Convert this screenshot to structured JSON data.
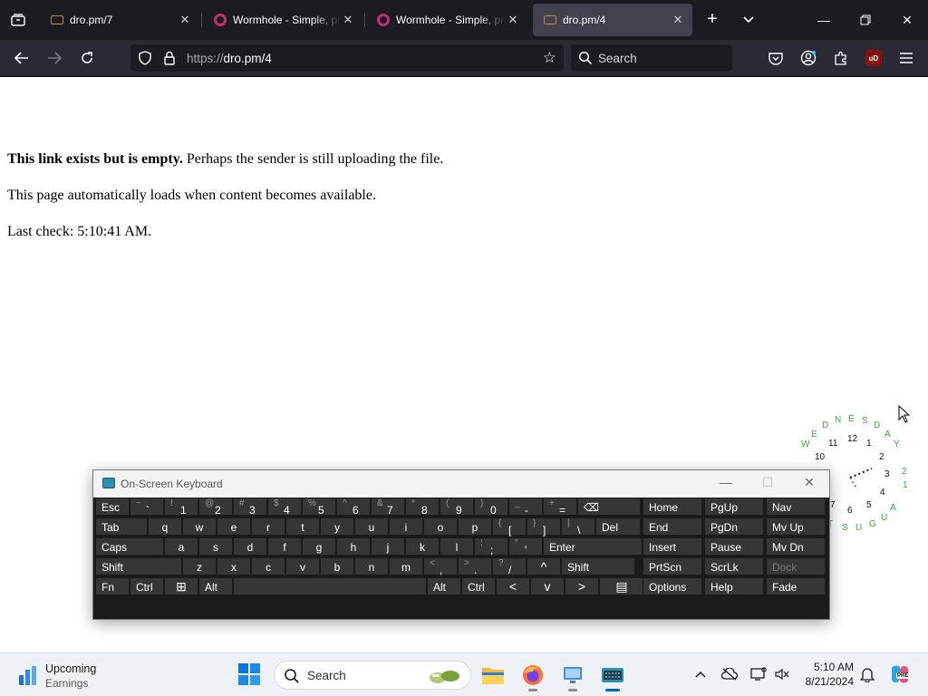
{
  "browser": {
    "tabs": [
      {
        "title": "dro.pm/7",
        "active": false,
        "favicon": "folder-favicon"
      },
      {
        "title": "Wormhole - Simple, private file sharing",
        "active": false,
        "favicon": "wormhole-favicon"
      },
      {
        "title": "Wormhole - Simple, private file sharing",
        "active": false,
        "favicon": "wormhole-favicon"
      },
      {
        "title": "dro.pm/4",
        "active": true,
        "favicon": "folder-favicon"
      }
    ],
    "url_prefix": "https://",
    "url_main": "dro.pm/4",
    "search_placeholder": "Search",
    "extension_badge": "uD"
  },
  "page": {
    "line1_bold": "This link exists but is empty.",
    "line1_rest": " Perhaps the sender is still uploading the file.",
    "line2": "This page automatically loads when content becomes available.",
    "line3": "Last check: 5:10:41 AM."
  },
  "clock": {
    "day_letters": [
      "W",
      "E",
      "D",
      "N",
      "E",
      "S",
      "D",
      "A",
      "Y"
    ],
    "hours": [
      "12",
      "1",
      "2",
      "3",
      "4",
      "5",
      "6",
      "7",
      "10",
      "11"
    ],
    "month_letters": [
      "A",
      "U",
      "G",
      "U",
      "S",
      "T"
    ],
    "date_digits": [
      "2",
      "1"
    ]
  },
  "osk": {
    "title": "On-Screen Keyboard",
    "rows": [
      [
        {
          "id": "esc",
          "label": "Esc"
        },
        {
          "id": "tilde",
          "shift": "~",
          "main": "`"
        },
        {
          "id": "1",
          "shift": "!",
          "main": "1"
        },
        {
          "id": "2",
          "shift": "@",
          "main": "2"
        },
        {
          "id": "3",
          "shift": "#",
          "main": "3"
        },
        {
          "id": "4",
          "shift": "$",
          "main": "4"
        },
        {
          "id": "5",
          "shift": "%",
          "main": "5"
        },
        {
          "id": "6",
          "shift": "^",
          "main": "6"
        },
        {
          "id": "7",
          "shift": "&",
          "main": "7"
        },
        {
          "id": "8",
          "shift": "*",
          "main": "8"
        },
        {
          "id": "9",
          "shift": "(",
          "main": "9"
        },
        {
          "id": "0",
          "shift": ")",
          "main": "0"
        },
        {
          "id": "minus",
          "shift": "_",
          "main": "-"
        },
        {
          "id": "equals",
          "shift": "+",
          "main": "="
        },
        {
          "id": "backspace",
          "label": "⌫"
        }
      ],
      [
        {
          "id": "tab",
          "label": "Tab"
        },
        {
          "id": "q",
          "label": "q"
        },
        {
          "id": "w",
          "label": "w"
        },
        {
          "id": "e",
          "label": "e"
        },
        {
          "id": "r",
          "label": "r"
        },
        {
          "id": "t",
          "label": "t"
        },
        {
          "id": "y",
          "label": "y"
        },
        {
          "id": "u",
          "label": "u"
        },
        {
          "id": "i",
          "label": "i"
        },
        {
          "id": "o",
          "label": "o"
        },
        {
          "id": "p",
          "label": "p"
        },
        {
          "id": "lbracket",
          "shift": "{",
          "main": "["
        },
        {
          "id": "rbracket",
          "shift": "}",
          "main": "]"
        },
        {
          "id": "backslash",
          "shift": "|",
          "main": "\\"
        },
        {
          "id": "del",
          "label": "Del"
        }
      ],
      [
        {
          "id": "caps",
          "label": "Caps"
        },
        {
          "id": "a",
          "label": "a"
        },
        {
          "id": "s",
          "label": "s"
        },
        {
          "id": "d",
          "label": "d"
        },
        {
          "id": "f",
          "label": "f"
        },
        {
          "id": "g",
          "label": "g"
        },
        {
          "id": "h",
          "label": "h"
        },
        {
          "id": "j",
          "label": "j"
        },
        {
          "id": "k",
          "label": "k"
        },
        {
          "id": "l",
          "label": "l"
        },
        {
          "id": "semicolon",
          "shift": ":",
          "main": ";"
        },
        {
          "id": "quote",
          "shift": "\"",
          "main": "'"
        },
        {
          "id": "enter",
          "label": "Enter"
        }
      ],
      [
        {
          "id": "lshift",
          "label": "Shift"
        },
        {
          "id": "z",
          "label": "z"
        },
        {
          "id": "x",
          "label": "x"
        },
        {
          "id": "c",
          "label": "c"
        },
        {
          "id": "v",
          "label": "v"
        },
        {
          "id": "b",
          "label": "b"
        },
        {
          "id": "n",
          "label": "n"
        },
        {
          "id": "m",
          "label": "m"
        },
        {
          "id": "comma",
          "shift": "<",
          "main": ","
        },
        {
          "id": "period",
          "shift": ">",
          "main": "."
        },
        {
          "id": "slash",
          "shift": "?",
          "main": "/"
        },
        {
          "id": "up",
          "label": "^"
        },
        {
          "id": "rshift",
          "label": "Shift"
        }
      ],
      [
        {
          "id": "fn",
          "label": "Fn"
        },
        {
          "id": "lctrl",
          "label": "Ctrl"
        },
        {
          "id": "win",
          "label": "⊞"
        },
        {
          "id": "lalt",
          "label": "Alt"
        },
        {
          "id": "space",
          "label": ""
        },
        {
          "id": "ralt",
          "label": "Alt"
        },
        {
          "id": "rctrl",
          "label": "Ctrl"
        },
        {
          "id": "left",
          "label": "<"
        },
        {
          "id": "down",
          "label": "v"
        },
        {
          "id": "right",
          "label": ">"
        },
        {
          "id": "menu",
          "label": "▤"
        }
      ]
    ],
    "nav_keys": [
      [
        "Home",
        "PgUp",
        "Nav"
      ],
      [
        "End",
        "PgDn",
        "Mv Up"
      ],
      [
        "Insert",
        "Pause",
        "Mv Dn"
      ],
      [
        "PrtScn",
        "ScrLk",
        "Dock"
      ],
      [
        "Options",
        "Help",
        "Fade"
      ]
    ]
  },
  "taskbar": {
    "widget_title": "Upcoming",
    "widget_subtitle": "Earnings",
    "search_placeholder": "Search",
    "time": "5:10 AM",
    "date": "8/21/2024",
    "copilot_badge": "PRE"
  }
}
